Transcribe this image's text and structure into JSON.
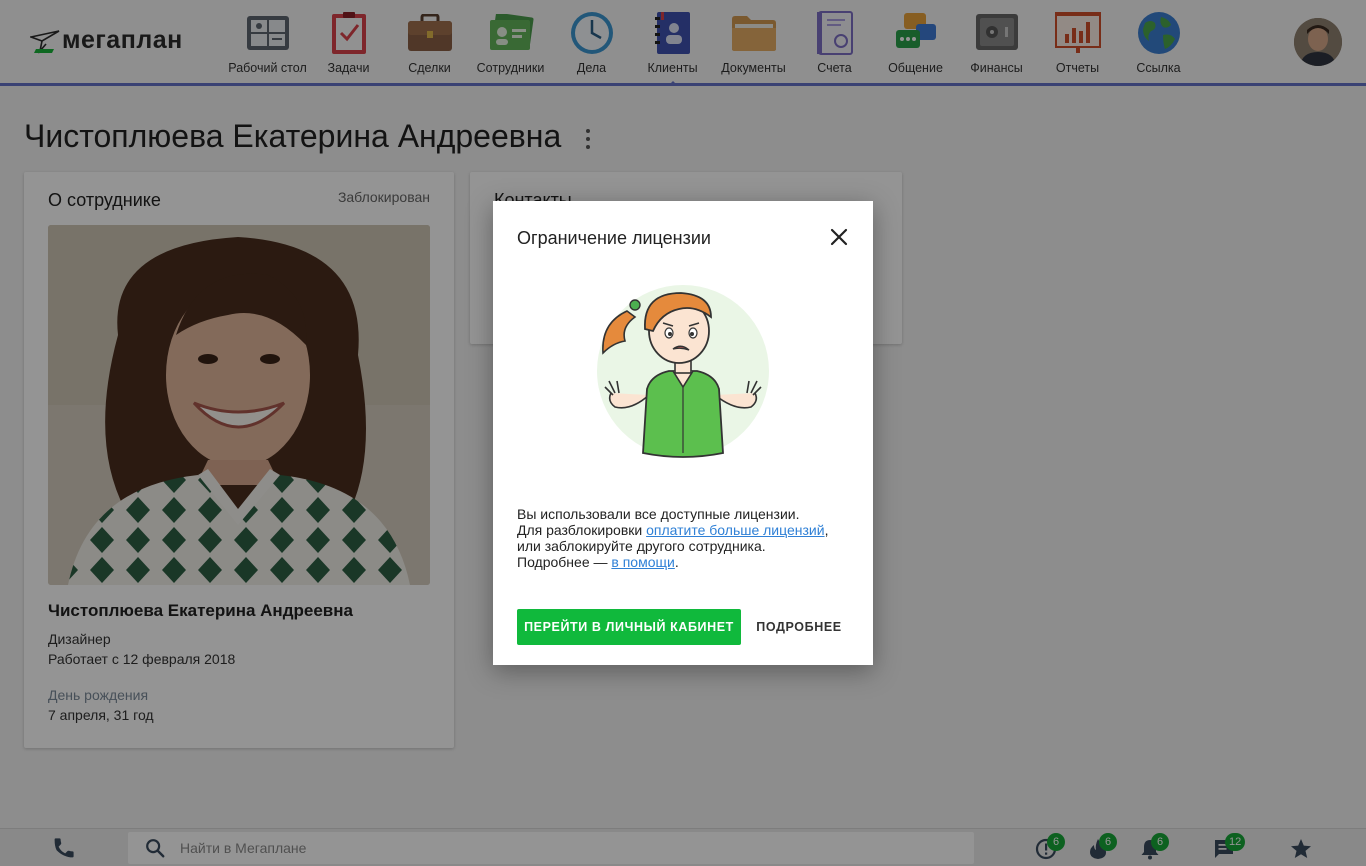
{
  "app": {
    "logo_text": "мегаплан",
    "brand_color": "#6572c9"
  },
  "nav": {
    "items": [
      {
        "label": "Рабочий стол",
        "icon": "desktop-icon"
      },
      {
        "label": "Задачи",
        "icon": "tasks-icon"
      },
      {
        "label": "Сделки",
        "icon": "briefcase-icon"
      },
      {
        "label": "Сотрудники",
        "icon": "employees-icon"
      },
      {
        "label": "Дела",
        "icon": "clock-icon"
      },
      {
        "label": "Клиенты",
        "icon": "clients-icon",
        "active": true
      },
      {
        "label": "Документы",
        "icon": "folder-icon"
      },
      {
        "label": "Счета",
        "icon": "invoice-icon"
      },
      {
        "label": "Общение",
        "icon": "chat-icon"
      },
      {
        "label": "Финансы",
        "icon": "safe-icon"
      },
      {
        "label": "Отчеты",
        "icon": "report-icon"
      },
      {
        "label": "Ссылка",
        "icon": "globe-icon"
      }
    ]
  },
  "page": {
    "title": "Чистоплюева Екатерина Андреевна"
  },
  "about_card": {
    "heading": "О сотруднике",
    "status": "Заблокирован",
    "name": "Чистоплюева Екатерина Андреевна",
    "role": "Дизайнер",
    "since": "Работает с 12 февраля 2018",
    "birthday_label": "День рождения",
    "birthday_value": "7 апреля, 31 год"
  },
  "contacts_card": {
    "heading": "Контакты"
  },
  "modal": {
    "title": "Ограничение лицензии",
    "line1": "Вы использовали все доступные лицензии.",
    "line2_prefix": "Для разблокировки ",
    "line2_link": "оплатите больше лицензий",
    "line2_suffix": ",",
    "line3": "или заблокируйте другого сотрудника.",
    "line4_prefix": "Подробнее — ",
    "line4_link": "в помощи",
    "line4_suffix": ".",
    "primary_button": "ПЕРЕЙТИ В ЛИЧНЫЙ КАБИНЕТ",
    "secondary_button": "ПОДРОБНЕЕ",
    "accent_color": "#10b93c"
  },
  "bottombar": {
    "search_placeholder": "Найти в Мегаплане",
    "badges": {
      "alerts": "6",
      "hot": "6",
      "notifications": "6",
      "messages": "12"
    }
  }
}
